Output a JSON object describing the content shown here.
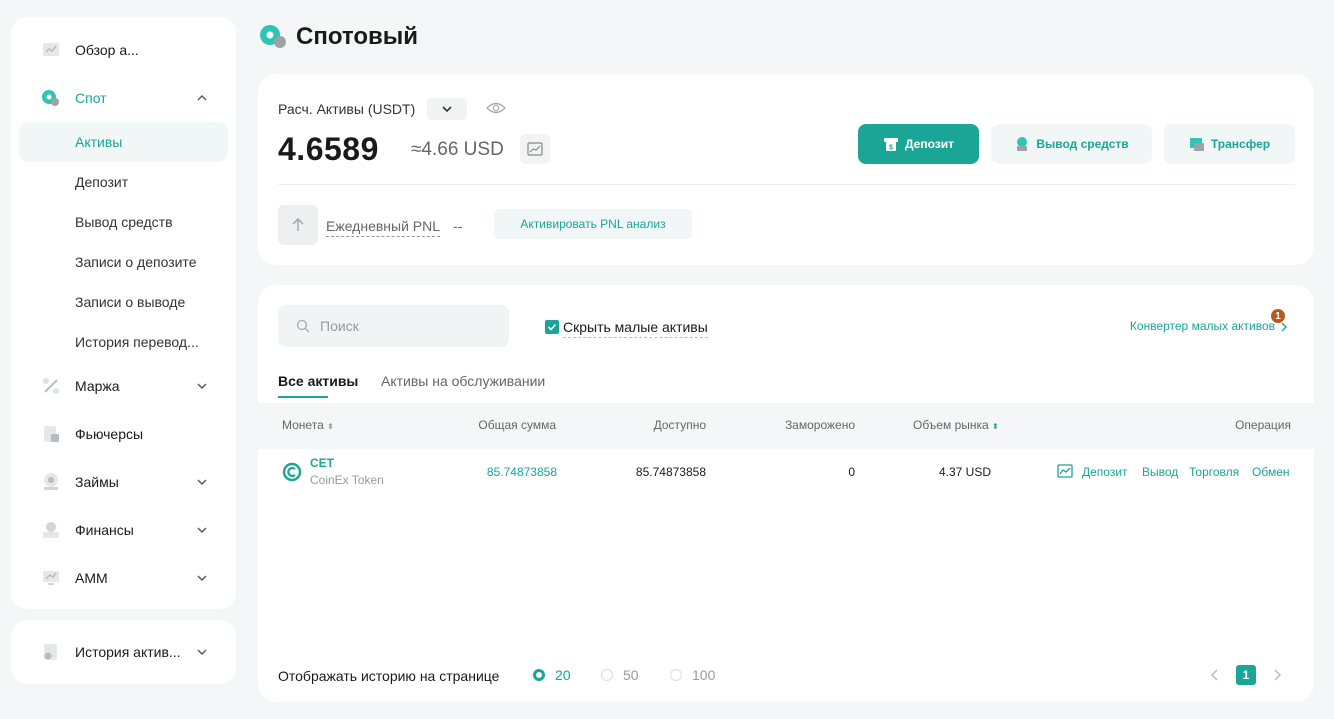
{
  "page": {
    "title": "Спотовый"
  },
  "sidebar": {
    "overview": "Обзор а...",
    "spot": "Спот",
    "spot_sub": [
      "Активы",
      "Депозит",
      "Вывод средств",
      "Записи о депозите",
      "Записи о выводе",
      "История перевод..."
    ],
    "margin": "Маржа",
    "futures": "Фьючерсы",
    "loans": "Займы",
    "finance": "Финансы",
    "amm": "AMM",
    "history": "История актив..."
  },
  "balance": {
    "label": "Расч. Активы (USDT)",
    "value": "4.6589",
    "usd": "≈4.66 USD",
    "deposit_btn": "Депозит",
    "withdraw_btn": "Вывод средств",
    "transfer_btn": "Трансфер",
    "pnl_label": "Ежедневный PNL",
    "pnl_value": "--",
    "pnl_activate": "Активировать PNL анализ"
  },
  "assets": {
    "search_placeholder": "Поиск",
    "hide_small": "Скрыть малые активы",
    "converter": "Конвертер малых активов",
    "converter_badge": "1",
    "tabs": [
      "Все активы",
      "Активы на обслуживании"
    ],
    "headers": {
      "coin": "Монета",
      "total": "Общая сумма",
      "available": "Доступно",
      "frozen": "Заморожено",
      "market_value": "Объем рынка",
      "operation": "Операция"
    },
    "row": {
      "symbol": "CET",
      "name": "CoinEx Token",
      "total": "85.74873858",
      "available": "85.74873858",
      "frozen": "0",
      "market_value": "4.37 USD",
      "ops": [
        "Депозит",
        "Вывод",
        "Торговля",
        "Обмен"
      ]
    },
    "per_page_label": "Отображать историю на странице",
    "per_page_options": [
      "20",
      "50",
      "100"
    ],
    "selected_per_page": "20",
    "current_page": "1"
  },
  "colors": {
    "accent": "#1ba597",
    "badge": "#b8591e"
  }
}
